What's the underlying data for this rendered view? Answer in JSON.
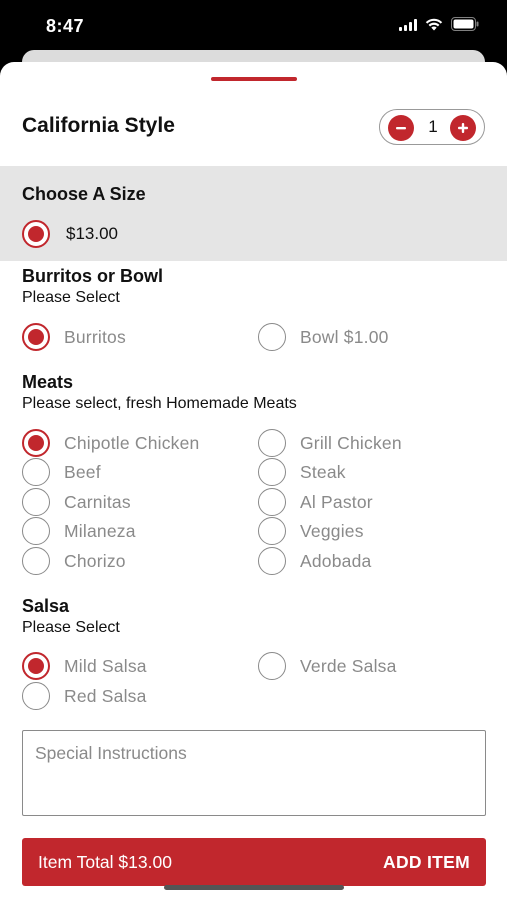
{
  "status_bar": {
    "time": "8:47"
  },
  "item": {
    "title": "California Style",
    "quantity": "1"
  },
  "size": {
    "title": "Choose A Size",
    "price": "$13.00",
    "selected": true
  },
  "burritos_bowl": {
    "title": "Burritos or Bowl",
    "subtitle": "Please Select",
    "options": [
      {
        "label": "Burritos",
        "selected": true
      },
      {
        "label": "Bowl $1.00",
        "selected": false
      }
    ]
  },
  "meats": {
    "title": "Meats",
    "subtitle": "Please select, fresh Homemade Meats",
    "options": [
      {
        "label": "Chipotle Chicken",
        "selected": true
      },
      {
        "label": "Grill Chicken",
        "selected": false
      },
      {
        "label": "Beef",
        "selected": false
      },
      {
        "label": "Steak",
        "selected": false
      },
      {
        "label": "Carnitas",
        "selected": false
      },
      {
        "label": "Al Pastor",
        "selected": false
      },
      {
        "label": "Milaneza",
        "selected": false
      },
      {
        "label": "Veggies",
        "selected": false
      },
      {
        "label": "Chorizo",
        "selected": false
      },
      {
        "label": "Adobada",
        "selected": false
      }
    ]
  },
  "salsa": {
    "title": "Salsa",
    "subtitle": "Please Select",
    "options": [
      {
        "label": "Mild Salsa",
        "selected": true
      },
      {
        "label": "Verde Salsa",
        "selected": false
      },
      {
        "label": "Red Salsa",
        "selected": false
      }
    ]
  },
  "special_instructions": {
    "placeholder": "Special Instructions",
    "value": ""
  },
  "footer": {
    "total_label": "Item Total $13.00",
    "add_label": "ADD ITEM"
  },
  "colors": {
    "accent": "#c1272d",
    "section_bg": "#e5e5e5",
    "muted_text": "#8a8a8a"
  }
}
